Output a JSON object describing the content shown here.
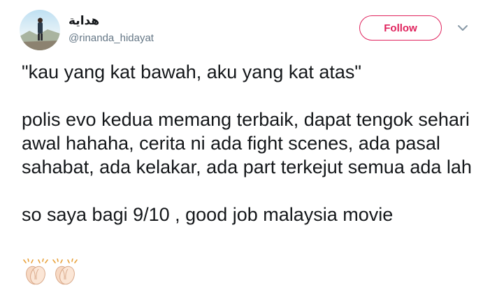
{
  "user": {
    "display_name": "هداية",
    "handle": "@rinanda_hidayat"
  },
  "actions": {
    "follow_label": "Follow",
    "more_icon": "chevron-down-icon"
  },
  "tweet": {
    "paragraphs": [
      "\"kau yang kat bawah, aku yang kat atas\"",
      "polis evo kedua memang terbaik, dapat tengok sehari awal hahaha, cerita ni ada fight scenes, ada pasal sahabat, ada kelakar, ada part terkejut semua ada lah",
      "so saya bagi 9/10 , good job malaysia movie"
    ],
    "emojis": [
      "clapping-hands-icon",
      "clapping-hands-icon"
    ]
  },
  "colors": {
    "accent": "#e0245e",
    "text": "#14171a",
    "secondary": "#657786"
  }
}
